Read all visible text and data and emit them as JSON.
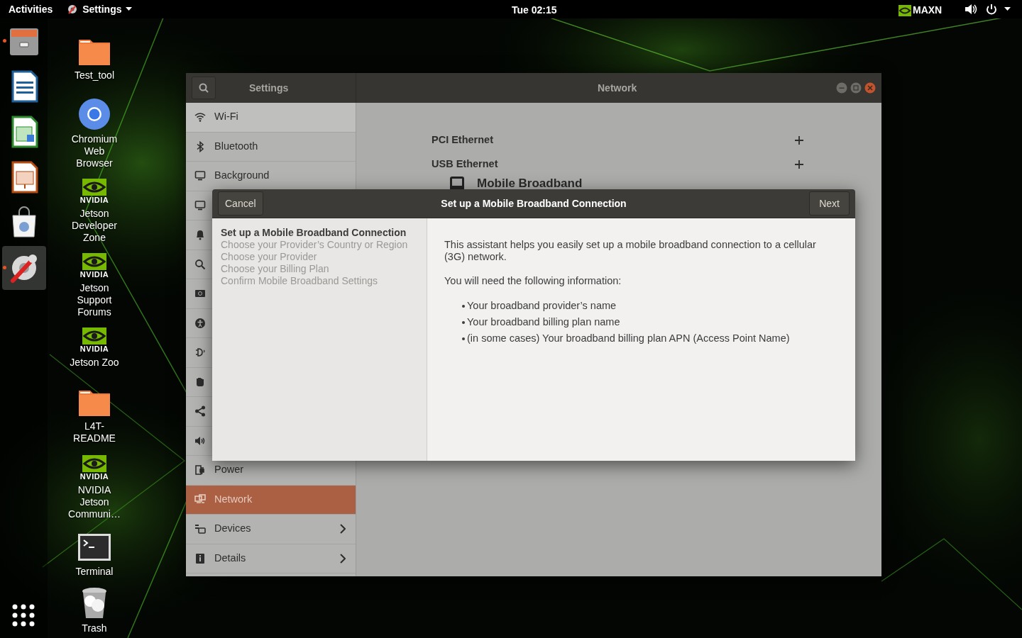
{
  "top_bar": {
    "activities": "Activities",
    "app_menu": "Settings",
    "clock": "Tue 02:15",
    "power_mode": "MAXN"
  },
  "dock": [
    {
      "running": true,
      "selected": false
    },
    {
      "running": false,
      "selected": false
    },
    {
      "running": false,
      "selected": false
    },
    {
      "running": false,
      "selected": false
    },
    {
      "running": false,
      "selected": false
    },
    {
      "running": true,
      "selected": true
    }
  ],
  "desktop_icons": [
    {
      "kind": "folder",
      "label": "Test_tool"
    },
    {
      "kind": "browser",
      "label": "Chromium Web Browser"
    },
    {
      "kind": "nvidia",
      "logo_text": "NVIDIA",
      "label": "Jetson Developer Zone"
    },
    {
      "kind": "nvidia",
      "logo_text": "NVIDIA",
      "label": "Jetson Support Forums"
    },
    {
      "kind": "nvidia",
      "logo_text": "NVIDIA",
      "label": "Jetson Zoo"
    },
    {
      "kind": "folder",
      "label": "L4T-README"
    },
    {
      "kind": "nvidia",
      "logo_text": "NVIDIA",
      "label": "NVIDIA Jetson Communi…"
    },
    {
      "kind": "terminal",
      "label": "Terminal"
    },
    {
      "kind": "trash",
      "label": "Trash"
    }
  ],
  "settings_window": {
    "title": "Settings",
    "panel_title": "Network",
    "sidebar": [
      {
        "label": "Wi-Fi",
        "selected": false,
        "submenu": false
      },
      {
        "label": "Bluetooth",
        "selected": false,
        "submenu": false
      },
      {
        "label": "Background",
        "selected": false,
        "submenu": false
      },
      {
        "selected": false,
        "submenu": false
      },
      {
        "selected": false,
        "submenu": false
      },
      {
        "selected": false,
        "submenu": false
      },
      {
        "selected": false,
        "submenu": false
      },
      {
        "selected": false,
        "submenu": false
      },
      {
        "selected": false,
        "submenu": false
      },
      {
        "selected": false,
        "submenu": false
      },
      {
        "selected": false,
        "submenu": false
      },
      {
        "selected": false,
        "submenu": false
      },
      {
        "label": "Power",
        "selected": false,
        "submenu": false
      },
      {
        "label": "Network",
        "selected": true,
        "submenu": false
      },
      {
        "label": "Devices",
        "selected": false,
        "submenu": true
      },
      {
        "label": "Details",
        "selected": false,
        "submenu": true
      }
    ],
    "sections": [
      {
        "label": "PCI Ethernet",
        "addable": true
      },
      {
        "label": "USB Ethernet",
        "addable": true
      },
      {
        "label": "Mobile Broadband",
        "addable": false
      }
    ]
  },
  "dialog": {
    "title": "Set up a Mobile Broadband Connection",
    "cancel": "Cancel",
    "next": "Next",
    "steps": [
      {
        "label": "Set up a Mobile Broadband Connection",
        "selected": true
      },
      {
        "label": "Choose your Provider’s Country or Region",
        "selected": false
      },
      {
        "label": "Choose your Provider",
        "selected": false
      },
      {
        "label": "Choose your Billing Plan",
        "selected": false
      },
      {
        "label": "Confirm Mobile Broadband Settings",
        "selected": false
      }
    ],
    "intro": "This assistant helps you easily set up a mobile broadband connection to a cellular (3G) network.",
    "info_heading": "You will need the following information:",
    "requirements": [
      "Your broadband provider’s name",
      "Your broadband billing plan name",
      "(in some cases) Your broadband billing plan APN (Access Point Name)"
    ]
  }
}
